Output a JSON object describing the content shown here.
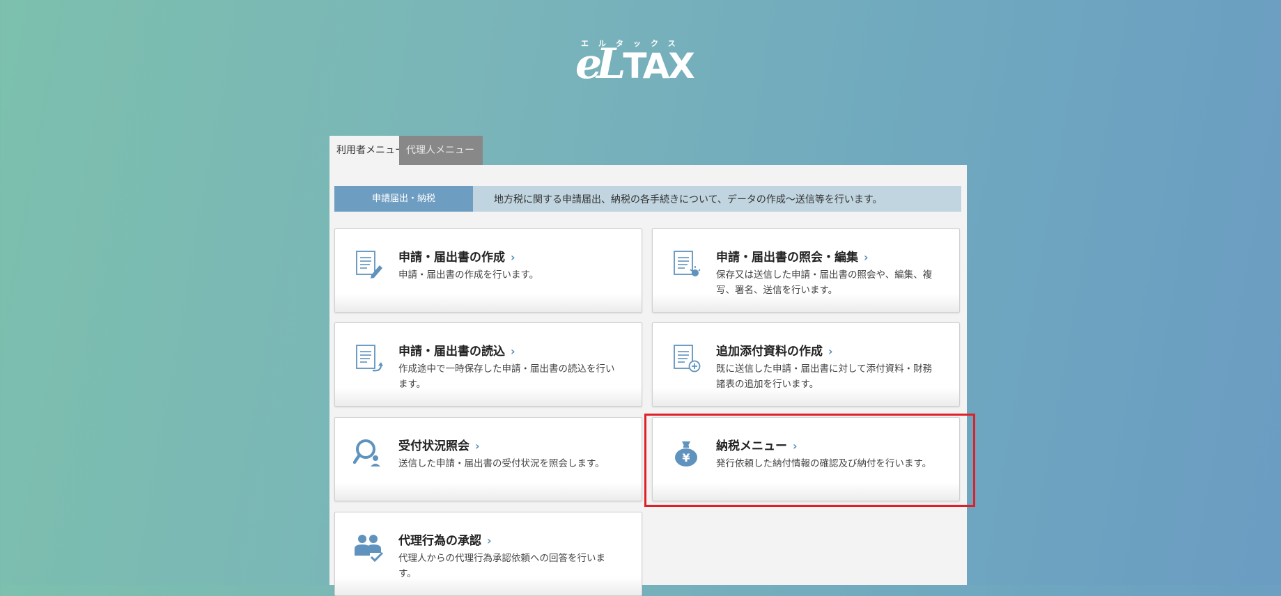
{
  "logo": {
    "kana": "エルタックス",
    "mark_el": "eL",
    "mark_tax": "TAX"
  },
  "tabs": [
    {
      "label": "利用者メニュー",
      "active": true
    },
    {
      "label": "代理人メニュー",
      "active": false
    }
  ],
  "info_bar": {
    "label": "申請届出・納税",
    "text": "地方税に関する申請届出、納税の各手続きについて、データの作成～送信等を行います。"
  },
  "cards": [
    {
      "icon": "document-pencil-icon",
      "title": "申請・届出書の作成",
      "desc": "申請・届出書の作成を行います。"
    },
    {
      "icon": "document-edit-icon",
      "title": "申請・届出書の照会・編集",
      "desc": "保存又は送信した申請・届出書の照会や、編集、複写、署名、送信を行います。"
    },
    {
      "icon": "document-load-icon",
      "title": "申請・届出書の読込",
      "desc": "作成途中で一時保存した申請・届出書の読込を行います。"
    },
    {
      "icon": "document-add-icon",
      "title": "追加添付資料の作成",
      "desc": "既に送信した申請・届出書に対して添付資料・財務諸表の追加を行います。"
    },
    {
      "icon": "magnifier-person-icon",
      "title": "受付状況照会",
      "desc": "送信した申請・届出書の受付状況を照会します。"
    },
    {
      "icon": "yen-bag-icon",
      "title": "納税メニュー",
      "desc": "発行依頼した納付情報の確認及び納付を行います。"
    },
    {
      "icon": "agents-approve-icon",
      "title": "代理行為の承認",
      "desc": "代理人からの代理行為承認依頼への回答を行います。"
    }
  ],
  "chevron": "›",
  "colors": {
    "accent": "#6e9dc2",
    "icon": "#5f93bd",
    "highlight": "#e02028"
  }
}
